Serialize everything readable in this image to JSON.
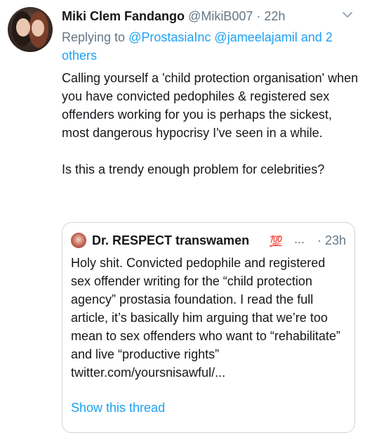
{
  "tweet": {
    "author_name": "Miki Clem Fandango",
    "author_handle": "@MikiB007",
    "separator": "·",
    "time": "22h",
    "replying_prefix": "Replying to",
    "replying_mention_1": "@ProstasiaInc",
    "replying_mention_2": "@jameelajamil",
    "replying_others": "and 2 others",
    "body_para_1": "Calling yourself a 'child protection organisation' when you have convicted pedophiles & registered sex offenders working for you is perhaps the sickest, most dangerous hypocrisy I've seen in a while.",
    "body_para_2": "Is this a trendy enough problem for celebrities?"
  },
  "quoted_tweet": {
    "author_name": "Dr. RESPECT transwamen",
    "emoji": "💯",
    "ellipsis": "...",
    "separator": "·",
    "time": "23h",
    "body": "Holy shit. Convicted pedophile and registered sex offender writing for the “child protection agency” prostasia foundation. I read the full article, it’s basically him arguing that we’re too mean to sex offenders who want to “rehabilitate” and live “productive rights” twitter.com/yoursnisawful/...",
    "show_thread": "Show this thread"
  },
  "icons": {
    "menu": "chevron-down-icon",
    "author_avatar": "avatar",
    "quoted_avatar": "avatar"
  },
  "colors": {
    "link": "#1da1f2",
    "secondary_text": "#657786",
    "primary_text": "#14171a",
    "border": "#ccd6dd"
  }
}
